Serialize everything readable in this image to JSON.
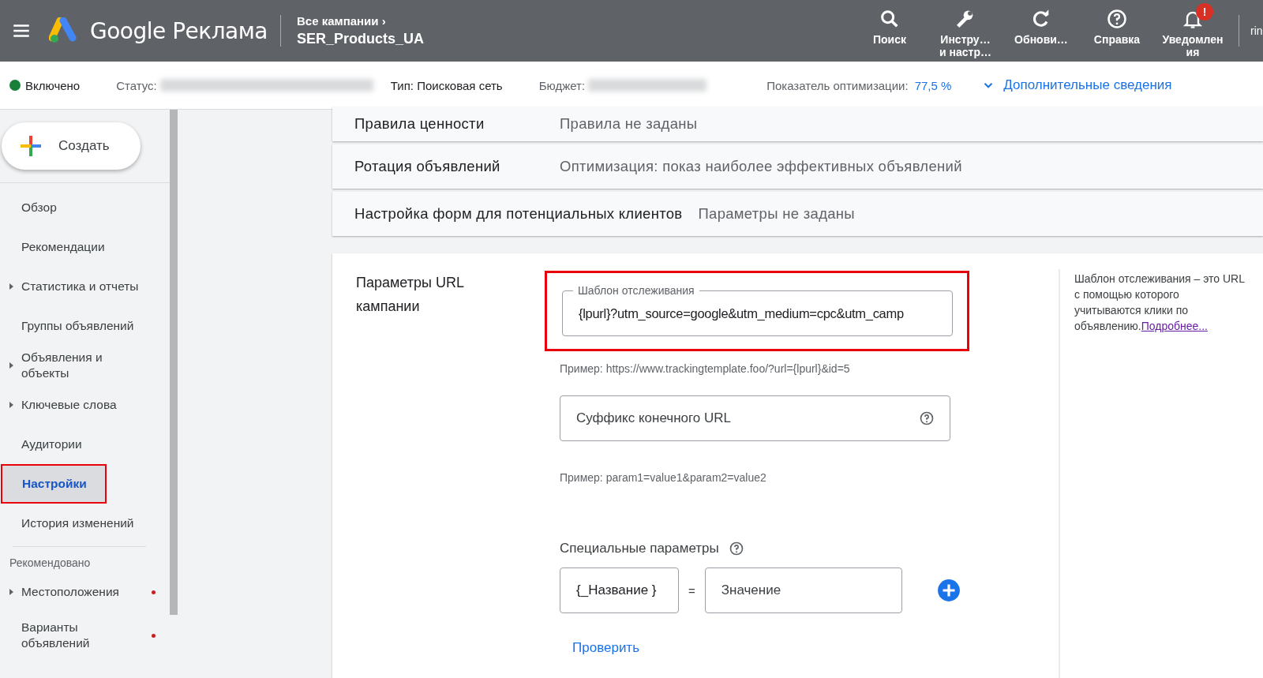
{
  "header": {
    "product": "Google Реклама",
    "breadcrumb": "Все кампании",
    "breadcrumb_arrow": "›",
    "campaign": "SER_Products_UA",
    "actions": [
      {
        "kind": "search",
        "label": "Поиск"
      },
      {
        "kind": "tools",
        "label": "Инстру…\nи настр…"
      },
      {
        "kind": "refresh",
        "label": "Обнови…"
      },
      {
        "kind": "help",
        "label": "Справка"
      },
      {
        "kind": "bell",
        "label": "Уведомлен\nия",
        "badge": "!"
      }
    ],
    "account": "rin"
  },
  "info_bar": {
    "state": "Включено",
    "status_label": "Статус:",
    "type": "Тип: Поисковая сеть",
    "budget_label": "Бюджет:",
    "score_label": "Показатель оптимизации:",
    "score": "77,5 %",
    "more": "Дополнительные сведения"
  },
  "create_button": "Создать",
  "sidebar": {
    "items": [
      {
        "label": "Обзор",
        "expandable": false,
        "selected": false,
        "highlighted": false,
        "dot": false
      },
      {
        "label": "Рекомендации",
        "expandable": false,
        "selected": false,
        "highlighted": false,
        "dot": false
      },
      {
        "label": "Статистика и отчеты",
        "expandable": true,
        "selected": false,
        "highlighted": false,
        "dot": false
      },
      {
        "label": "Группы объявлений",
        "expandable": false,
        "selected": false,
        "highlighted": false,
        "dot": false
      },
      {
        "label": "Объявления и объекты",
        "expandable": true,
        "selected": false,
        "highlighted": false,
        "dot": false
      },
      {
        "label": "Ключевые слова",
        "expandable": true,
        "selected": false,
        "highlighted": false,
        "dot": false
      },
      {
        "label": "Аудитории",
        "expandable": false,
        "selected": false,
        "highlighted": false,
        "dot": false
      },
      {
        "label": "Настройки",
        "expandable": false,
        "selected": true,
        "highlighted": true,
        "dot": false
      },
      {
        "label": "История изменений",
        "expandable": false,
        "selected": false,
        "highlighted": false,
        "dot": false
      }
    ],
    "section": "Рекомендовано",
    "recommended": [
      {
        "label": "Местоположения",
        "expandable": true,
        "selected": false,
        "highlighted": false,
        "dot": true
      },
      {
        "label": "Варианты объявлений",
        "expandable": false,
        "selected": false,
        "highlighted": false,
        "dot": true
      }
    ]
  },
  "settings_rows": [
    {
      "label": "Правила ценности",
      "value": "Правила не заданы"
    },
    {
      "label": "Ротация объявлений",
      "value": "Оптимизация: показ наиболее эффективных объявлений"
    },
    {
      "label": "Настройка форм для потенциальных клиентов",
      "value": "Параметры не заданы"
    }
  ],
  "url_card": {
    "title": "Параметры URL кампании",
    "tracking": {
      "label": "Шаблон отслеживания",
      "value": "{lpurl}?utm_source=google&utm_medium=cpc&utm_camp",
      "highlighted": true,
      "example": "Пример: https://www.trackingtemplate.foo/?url={lpurl}&id=5"
    },
    "suffix": {
      "placeholder": "Суффикс конечного URL",
      "example": "Пример: param1=value1&param2=value2"
    },
    "custom_label": "Специальные параметры",
    "custom_name": "{_Название }",
    "equals": "=",
    "custom_value_placeholder": "Значение",
    "check": "Проверить",
    "help_lines": [
      "Шаблон отслеживания – это URL",
      "с помощью которого",
      "учитываются клики по",
      "объявлению."
    ],
    "help_link": "Подробнее..."
  }
}
